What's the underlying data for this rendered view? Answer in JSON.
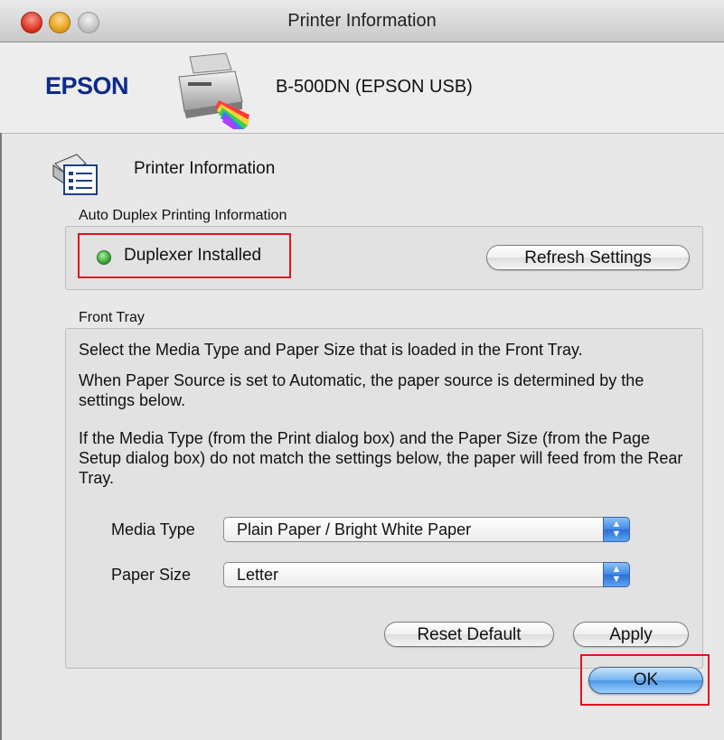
{
  "window": {
    "title": "Printer Information"
  },
  "header": {
    "brand": "EPSON",
    "printer_model": "B-500DN (EPSON USB)"
  },
  "section": {
    "title": "Printer Information"
  },
  "duplex": {
    "group_label": "Auto Duplex Printing Information",
    "status": "Duplexer Installed",
    "refresh_label": "Refresh Settings"
  },
  "front_tray": {
    "group_label": "Front Tray",
    "para1": "Select the Media Type and Paper Size that is loaded in the Front Tray.",
    "para2": "When Paper Source is set to Automatic, the paper source is determined by the settings below.",
    "para3": "If the Media Type (from the Print dialog box) and the Paper Size (from the Page Setup dialog box) do not match the settings below, the paper will feed from the Rear Tray.",
    "media_type_label": "Media Type",
    "media_type_value": "Plain Paper / Bright White Paper",
    "paper_size_label": "Paper Size",
    "paper_size_value": "Letter",
    "reset_label": "Reset Default",
    "apply_label": "Apply"
  },
  "footer": {
    "ok_label": "OK"
  },
  "colors": {
    "highlight": "#e0131f",
    "brand": "#0b2a8a",
    "led": "#2c9a2c"
  }
}
